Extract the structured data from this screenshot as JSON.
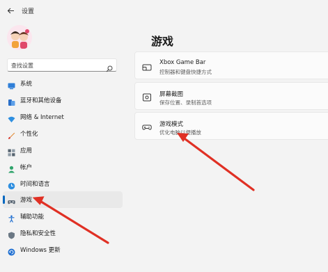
{
  "window": {
    "title": "设置"
  },
  "search": {
    "placeholder": "查找设置"
  },
  "nav": {
    "items": [
      {
        "label": "系统",
        "icon": "monitor-icon"
      },
      {
        "label": "蓝牙和其他设备",
        "icon": "bluetooth-devices-icon"
      },
      {
        "label": "网络 & Internet",
        "icon": "wifi-icon"
      },
      {
        "label": "个性化",
        "icon": "brush-icon"
      },
      {
        "label": "应用",
        "icon": "apps-icon"
      },
      {
        "label": "帐户",
        "icon": "person-icon"
      },
      {
        "label": "时间和语言",
        "icon": "globe-clock-icon"
      },
      {
        "label": "游戏",
        "icon": "gamepad-icon",
        "selected": true
      },
      {
        "label": "辅助功能",
        "icon": "accessibility-icon"
      },
      {
        "label": "隐私和安全性",
        "icon": "shield-icon"
      },
      {
        "label": "Windows 更新",
        "icon": "windows-update-icon"
      }
    ]
  },
  "main": {
    "title": "游戏",
    "cards": [
      {
        "title": "Xbox Game Bar",
        "subtitle": "控制器和键盘快捷方式",
        "icon": "game-bar-icon"
      },
      {
        "title": "屏幕截图",
        "subtitle": "保存位置、录制首选项",
        "icon": "capture-icon"
      },
      {
        "title": "游戏模式",
        "subtitle": "优化电脑以便播放",
        "icon": "game-mode-icon"
      }
    ]
  },
  "colors": {
    "accent": "#0067c0",
    "annotation_arrow": "#e03024",
    "background": "#f3f3f3"
  }
}
